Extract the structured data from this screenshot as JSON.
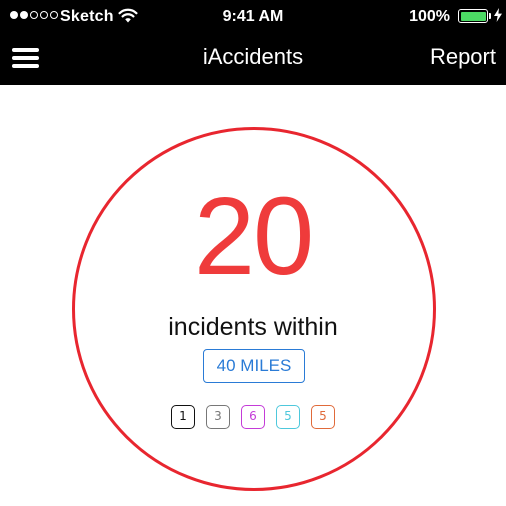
{
  "status_bar": {
    "signal_dots": [
      true,
      true,
      false,
      false,
      false
    ],
    "carrier": "Sketch",
    "wifi_icon": "wifi-icon",
    "time": "9:41 AM",
    "battery_percent": "100%",
    "battery_icon": "battery-icon",
    "charging_icon": "bolt-icon"
  },
  "nav": {
    "menu_icon": "hamburger-menu-icon",
    "title": "iAccidents",
    "report_label": "Report"
  },
  "main": {
    "incident_count": "20",
    "subtitle": "incidents within",
    "radius_label": "40 MILES",
    "badges": [
      {
        "label": "1",
        "color": "#111111"
      },
      {
        "label": "3",
        "color": "#777777"
      },
      {
        "label": "6",
        "color": "#c43bd8"
      },
      {
        "label": "5",
        "color": "#4ec8dc"
      },
      {
        "label": "5",
        "color": "#e06a3a"
      }
    ]
  },
  "colors": {
    "header_background": "#000000",
    "accent_red": "#e8262f",
    "accent_blue": "#2a7bd6",
    "battery_green": "#4cd964"
  }
}
